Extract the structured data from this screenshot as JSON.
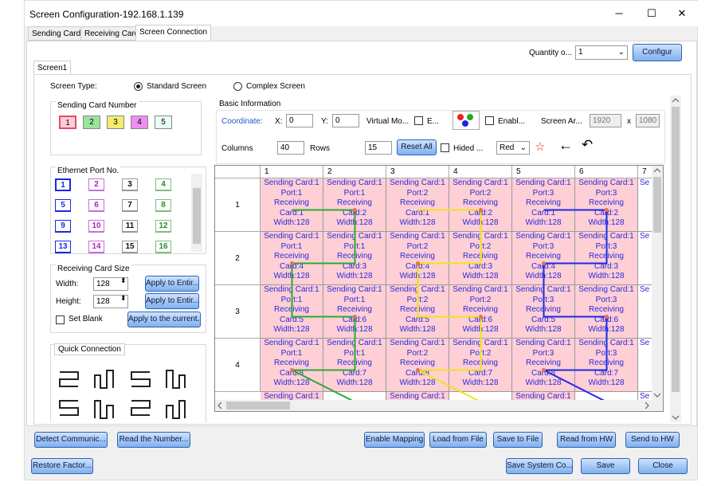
{
  "window": {
    "title": "Screen Configuration-192.168.1.139",
    "minimize": "─",
    "maximize": "☐",
    "close": "✕"
  },
  "tabs": [
    "Sending Card",
    "Receiving Card",
    "Screen Connection"
  ],
  "quantity": {
    "label": "Quantity o...",
    "value": "1",
    "configure": "Configur"
  },
  "screen_tab": "Screen1",
  "screen_type": {
    "label": "Screen Type:",
    "standard": "Standard Screen",
    "complex": "Complex Screen"
  },
  "sending_card_number": {
    "title": "Sending Card Number",
    "cards": [
      "1",
      "2",
      "3",
      "4",
      "5"
    ]
  },
  "ethernet": {
    "title": "Ethernet Port No.",
    "ports": [
      "1",
      "2",
      "3",
      "4",
      "5",
      "6",
      "7",
      "8",
      "9",
      "10",
      "11",
      "12",
      "13",
      "14",
      "15",
      "16"
    ]
  },
  "rcv_size": {
    "title": "Receiving Card Size",
    "width_label": "Width:",
    "width": "128",
    "height_label": "Height:",
    "height": "128",
    "apply_w": "Apply to Entir...",
    "apply_h": "Apply to Entir...",
    "set_blank": "Set Blank",
    "apply_current": "Apply to the current..."
  },
  "quick": {
    "title": "Quick Connection"
  },
  "basic": {
    "title": "Basic Information",
    "coordinate": "Coordinate:",
    "x_label": "X:",
    "x": "0",
    "y_label": "Y:",
    "y": "0",
    "virtual": "Virtual Mo...",
    "e": "E...",
    "enable": "Enabl...",
    "screen_area": "Screen Ar...",
    "sw": "1920",
    "xsep": "x",
    "sh": "1080",
    "columns": "Columns",
    "cols": "40",
    "rows_label": "Rows",
    "rows": "15",
    "reset": "Reset All",
    "hidden": "Hided ...",
    "color": "Red"
  },
  "grid": {
    "col_headers": [
      "1",
      "2",
      "3",
      "4",
      "5",
      "6",
      "7"
    ],
    "row_headers": [
      "1",
      "2",
      "3",
      "4"
    ],
    "rows": [
      [
        [
          "Sending Card:1",
          "Port:1",
          "Receiving",
          "Card:1",
          "Width:128"
        ],
        [
          "Sending Card:1",
          "Port:1",
          "Receiving",
          "Card:2",
          "Width:128"
        ],
        [
          "Sending Card:1",
          "Port:2",
          "Receiving",
          "Card:1",
          "Width:128"
        ],
        [
          "Sending Card:1",
          "Port:2",
          "Receiving",
          "Card:2",
          "Width:128"
        ],
        [
          "Sending Card:1",
          "Port:3",
          "Receiving",
          "Card:1",
          "Width:128"
        ],
        [
          "Sending Card:1",
          "Port:3",
          "Receiving",
          "Card:2",
          "Width:128"
        ],
        [
          "Se",
          "",
          "",
          "",
          ""
        ]
      ],
      [
        [
          "Sending Card:1",
          "Port:1",
          "Receiving",
          "Card:4",
          "Width:128"
        ],
        [
          "Sending Card:1",
          "Port:1",
          "Receiving",
          "Card:3",
          "Width:128"
        ],
        [
          "Sending Card:1",
          "Port:2",
          "Receiving",
          "Card:4",
          "Width:128"
        ],
        [
          "Sending Card:1",
          "Port:2",
          "Receiving",
          "Card:3",
          "Width:128"
        ],
        [
          "Sending Card:1",
          "Port:3",
          "Receiving",
          "Card:4",
          "Width:128"
        ],
        [
          "Sending Card:1",
          "Port:3",
          "Receiving",
          "Card:3",
          "Width:128"
        ],
        [
          "Se",
          "",
          "",
          "",
          ""
        ]
      ],
      [
        [
          "Sending Card:1",
          "Port:1",
          "Receiving",
          "Card:5",
          "Width:128"
        ],
        [
          "Sending Card:1",
          "Port:1",
          "Receiving",
          "Card:6",
          "Width:128"
        ],
        [
          "Sending Card:1",
          "Port:2",
          "Receiving",
          "Card:5",
          "Width:128"
        ],
        [
          "Sending Card:1",
          "Port:2",
          "Receiving",
          "Card:6",
          "Width:128"
        ],
        [
          "Sending Card:1",
          "Port:3",
          "Receiving",
          "Card:5",
          "Width:128"
        ],
        [
          "Sending Card:1",
          "Port:3",
          "Receiving",
          "Card:6",
          "Width:128"
        ],
        [
          "Se",
          "",
          "",
          "",
          ""
        ]
      ],
      [
        [
          "Sending Card:1",
          "Port:1",
          "Receiving",
          "Card:8",
          "Width:128"
        ],
        [
          "Sending Card:1",
          "Port:1",
          "Receiving",
          "Card:7",
          "Width:128"
        ],
        [
          "Sending Card:1",
          "Port:2",
          "Receiving",
          "Card:8",
          "Width:128"
        ],
        [
          "Sending Card:1",
          "Port:2",
          "Receiving",
          "Card:7",
          "Width:128"
        ],
        [
          "Sending Card:1",
          "Port:3",
          "Receiving",
          "Card:8",
          "Width:128"
        ],
        [
          "Sending Card:1",
          "Port:3",
          "Receiving",
          "Card:7",
          "Width:128"
        ],
        [
          "Se",
          "",
          "",
          "",
          ""
        ]
      ]
    ],
    "partial_row": [
      "Sending Card:1",
      "",
      "Sending Card:1",
      "",
      "Sending Card:1",
      "",
      "Se"
    ]
  },
  "bottom": {
    "detect": "Detect Communic...",
    "read_number": "Read the Number...",
    "enable_mapping": "Enable Mapping",
    "load_file": "Load from File",
    "save_file": "Save to File",
    "read_hw": "Read from HW",
    "send_hw": "Send to HW",
    "restore": "Restore Factor...",
    "save_system": "Save System Co...",
    "save": "Save",
    "close": "Close"
  },
  "colors": {
    "port1": "#2fa82f",
    "port2": "#f2e21a",
    "port3": "#1a2ae8",
    "cell": "#ffcfd6",
    "text": "#2a2ad8"
  }
}
